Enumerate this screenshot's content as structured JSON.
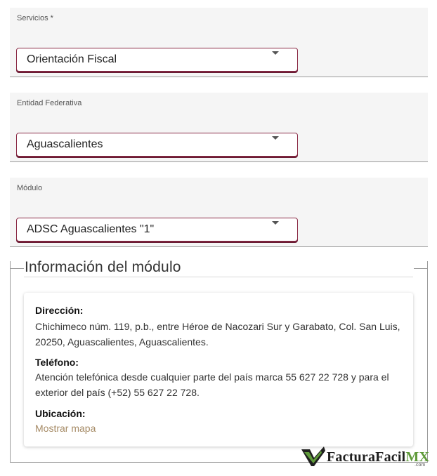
{
  "fields": {
    "servicios": {
      "label": "Servicios *",
      "value": "Orientación Fiscal"
    },
    "entidad": {
      "label": "Entidad Federativa",
      "value": "Aguascalientes"
    },
    "modulo": {
      "label": "Módulo",
      "value": "ADSC Aguascalientes \"1\""
    }
  },
  "info": {
    "title": "Información del módulo",
    "direccion_label": "Dirección:",
    "direccion_text": "Chichimeco núm. 119, p.b., entre Héroe de Nacozari Sur y Garabato, Col. San Luis, 20250, Aguascalientes, Aguascalientes.",
    "telefono_label": "Teléfono:",
    "telefono_text": "Atención telefónica desde cualquier parte del país marca 55 627 22 728 y para el exterior del país (+52) 55 627 22 728.",
    "ubicacion_label": "Ubicación:",
    "mapa_link": "Mostrar mapa"
  },
  "logo": {
    "brand": "FacturaFacil",
    "suffix": "MX",
    "sub": ".com"
  },
  "colors": {
    "select_border": "#8a2a45",
    "link": "#a68b66",
    "logo_green": "#5f9a3a"
  },
  "icons": {
    "select_arrow": "chevron-down-icon",
    "logo_mark": "checkmark-logo-icon"
  }
}
